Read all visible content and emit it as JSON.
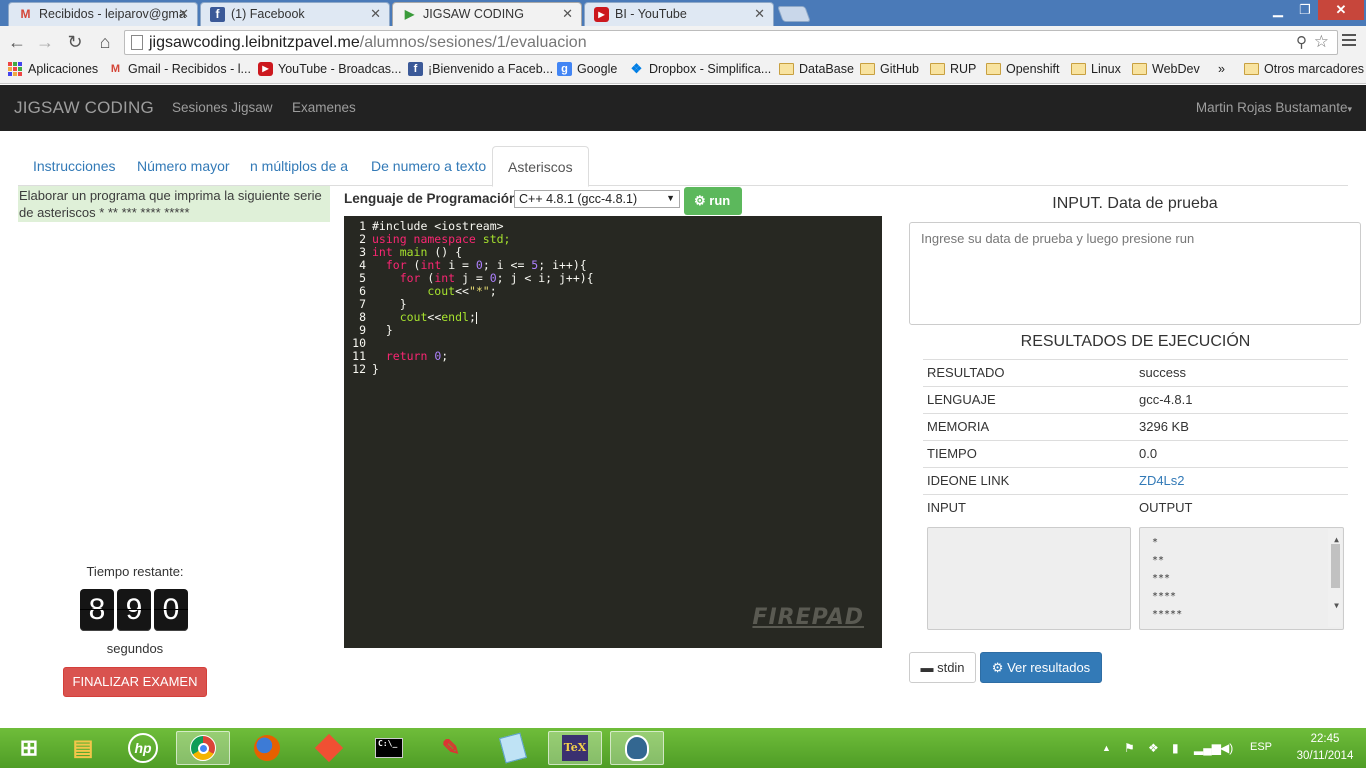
{
  "browser": {
    "tabs": [
      {
        "label": "Recibidos - leiparov@gma",
        "icon": "gmail-icon"
      },
      {
        "label": "(1) Facebook",
        "icon": "facebook-icon"
      },
      {
        "label": "JIGSAW CODING",
        "icon": "play-icon"
      },
      {
        "label": "BI - YouTube",
        "icon": "youtube-icon"
      }
    ],
    "url_domain": "jigsawcoding.leibnitzpavel.me",
    "url_path": "/alumnos/sesiones/1/evaluacion",
    "bookmarks": [
      "Aplicaciones",
      "Gmail - Recibidos - l...",
      "YouTube - Broadcas...",
      "¡Bienvenido a Faceb...",
      "Google",
      "Dropbox - Simplifica...",
      "DataBase",
      "GitHub",
      "RUP",
      "Openshift",
      "Linux",
      "WebDev",
      "»",
      "Otros marcadores"
    ]
  },
  "app": {
    "brand": "JIGSAW CODING",
    "nav": [
      "Sesiones Jigsaw",
      "Examenes"
    ],
    "user": "Martin Rojas Bustamante"
  },
  "tabs": [
    "Instrucciones",
    "Número mayor",
    "n múltiplos de a",
    "De numero a texto",
    "Asteriscos"
  ],
  "active_tab": "Asteriscos",
  "instructions": {
    "line1": "Elaborar un programa que imprima la siguiente serie",
    "line2": "de asteriscos * ** *** **** *****"
  },
  "timer": {
    "label": "Tiempo restante:",
    "digits": [
      "8",
      "9",
      "0"
    ],
    "unit": "segundos",
    "finish_label": "FINALIZAR EXAMEN"
  },
  "editor": {
    "lang_label": "Lenguaje de Programación",
    "lang_value": "C++ 4.8.1 (gcc-4.8.1)",
    "run_label": "run",
    "logo": "FIREPAD",
    "line_numbers": [
      "1",
      "2",
      "3",
      "4",
      "5",
      "6",
      "7",
      "8",
      "9",
      "10",
      "11",
      "12"
    ],
    "code": {
      "l1": "#include <iostream>",
      "l2a": "using namespace",
      "l2b": " std;",
      "l3a": "int",
      "l3b": " main",
      "l3c": " () {",
      "l4a": "  for",
      "l4b": " (",
      "l4c": "int",
      "l4d": " i = ",
      "l4e": "0",
      "l4f": "; i <= ",
      "l4g": "5",
      "l4h": "; i++){",
      "l5a": "    for",
      "l5b": " (",
      "l5c": "int",
      "l5d": " j = ",
      "l5e": "0",
      "l5f": "; j < i; j++){",
      "l6a": "        cout",
      "l6b": "<<",
      "l6c": "\"*\"",
      "l6d": ";",
      "l7": "    }",
      "l8a": "    cout",
      "l8b": "<<",
      "l8c": "endl",
      "l8d": ";",
      "l9": "  }",
      "l10": "",
      "l11a": "  return",
      "l11b": " ",
      "l11c": "0",
      "l11d": ";",
      "l12": "}"
    }
  },
  "input": {
    "title": "INPUT. Data de prueba",
    "placeholder": "Ingrese su data de prueba y luego presione run"
  },
  "results": {
    "title": "RESULTADOS DE EJECUCIÓN",
    "rows": [
      {
        "key": "RESULTADO",
        "value": "success"
      },
      {
        "key": "LENGUAJE",
        "value": "gcc-4.8.1"
      },
      {
        "key": "MEMORIA",
        "value": "3296 KB"
      },
      {
        "key": "TIEMPO",
        "value": "0.0"
      },
      {
        "key": "IDEONE LINK",
        "value": "ZD4Ls2"
      },
      {
        "key": "INPUT",
        "value": "OUTPUT"
      }
    ],
    "output_lines": [
      "*",
      "**",
      "***",
      "****",
      "*****"
    ],
    "stdin_label": "stdin",
    "results_button": "Ver resultados"
  },
  "taskbar": {
    "language": "ESP",
    "time": "22:45",
    "date": "30/11/2014"
  },
  "colors": {
    "navbar": "#222222",
    "run_button": "#5cb85c",
    "finish_button": "#d9534f",
    "results_button": "#337ab7",
    "instructions_bg": "#dff0d8",
    "editor_bg": "#272822",
    "taskbar": "#5aa82e"
  }
}
